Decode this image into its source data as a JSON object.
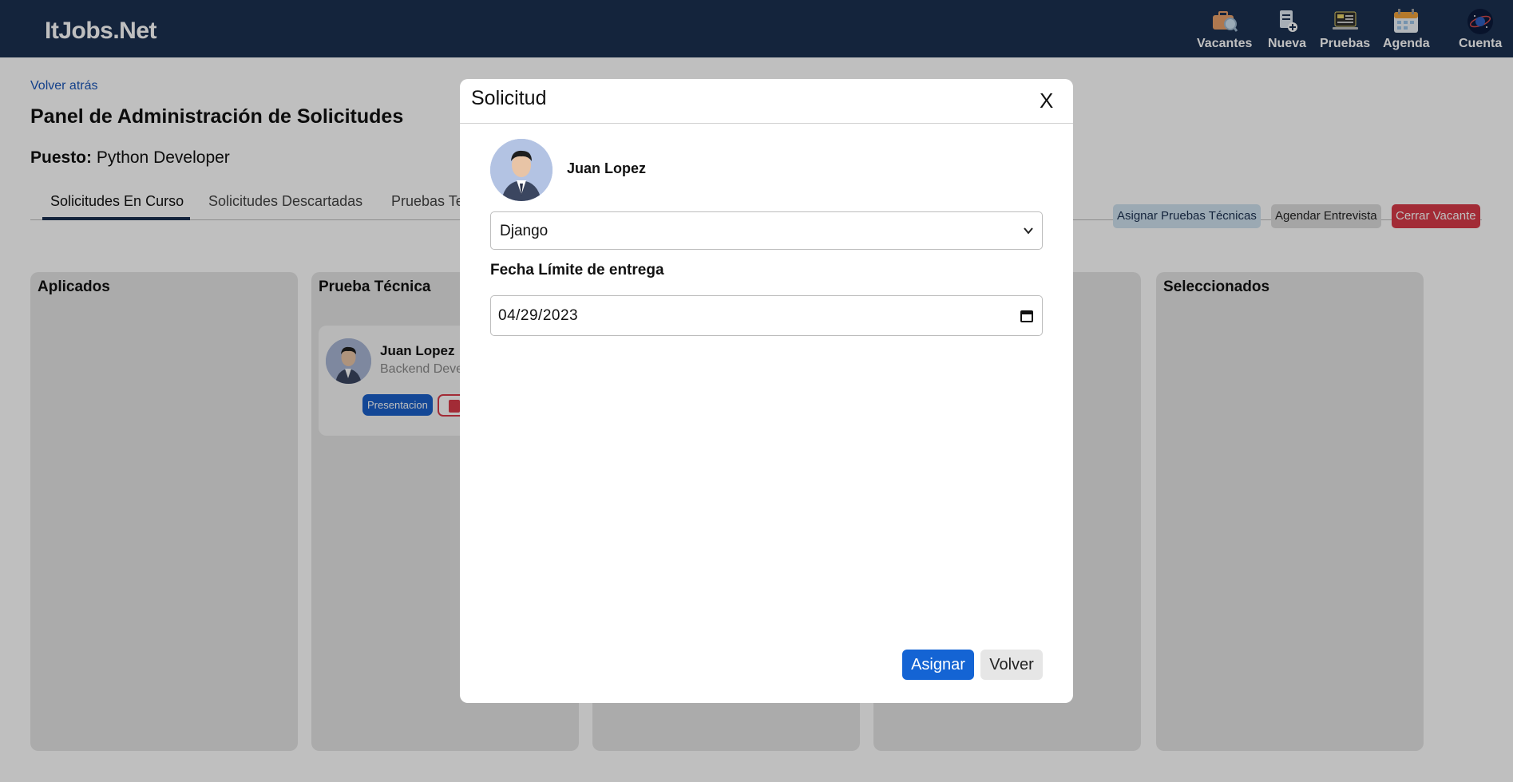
{
  "navbar": {
    "brand": "ItJobs.Net",
    "items": [
      {
        "label": "Vacantes",
        "icon": "briefcase-search-icon"
      },
      {
        "label": "Nueva",
        "icon": "new-document-icon"
      },
      {
        "label": "Pruebas",
        "icon": "code-laptop-icon"
      },
      {
        "label": "Agenda",
        "icon": "calendar-icon"
      },
      {
        "label": "Cuenta",
        "icon": "account-avatar-icon"
      }
    ]
  },
  "page": {
    "back_link": "Volver atrás",
    "title": "Panel de Administración de Solicitudes",
    "puesto_label": "Puesto:",
    "puesto_value": "Python Developer",
    "tabs": [
      {
        "label": "Solicitudes En Curso",
        "active": true
      },
      {
        "label": "Solicitudes Descartadas",
        "active": false
      },
      {
        "label": "Pruebas Te",
        "active": false
      }
    ],
    "actions": {
      "asignar_pruebas": "Asignar Pruebas Técnicas",
      "agendar": "Agendar Entrevista",
      "cerrar": "Cerrar Vacante"
    },
    "columns": [
      {
        "title": "Aplicados"
      },
      {
        "title": "Prueba Técnica"
      },
      {
        "title": ""
      },
      {
        "title": ""
      },
      {
        "title": "Seleccionados"
      }
    ],
    "card": {
      "name": "Juan Lopez",
      "role": "Backend Deve",
      "presentation_label": "Presentacion",
      "pdf_icon": "pdf-icon"
    }
  },
  "modal": {
    "title": "Solicitud",
    "close_label": "X",
    "candidate_name": "Juan Lopez",
    "select_value": "Django",
    "date_label": "Fecha Límite de entrega",
    "date_value": "04/29/2023",
    "submit_label": "Asignar",
    "back_label": "Volver"
  },
  "colors": {
    "navbar": "#1b3050",
    "primary": "#1464d4",
    "danger": "#d93a48",
    "info": "#cfe2ef"
  }
}
